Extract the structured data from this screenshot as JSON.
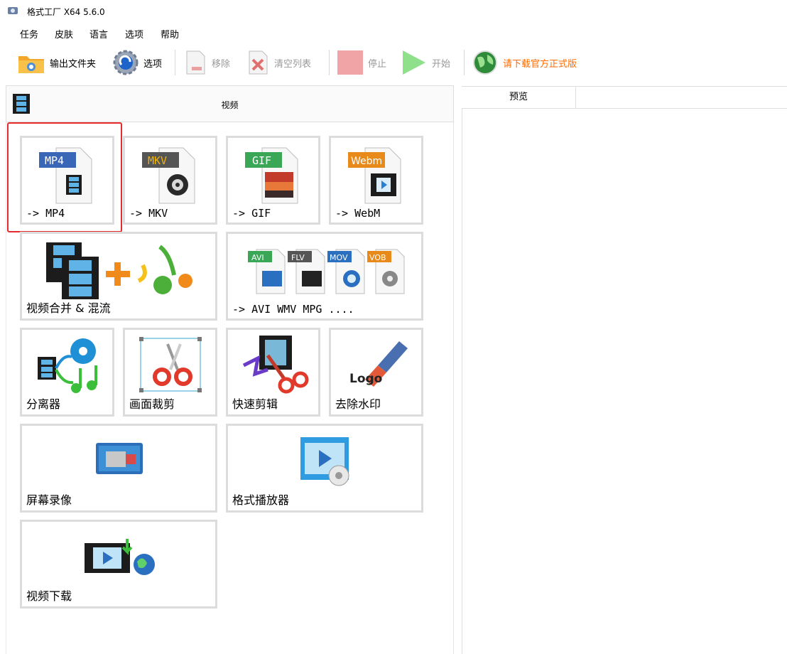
{
  "window": {
    "title": "格式工厂 X64 5.6.0",
    "icon": "format-factory-icon"
  },
  "menu": [
    "任务",
    "皮肤",
    "语言",
    "选项",
    "帮助"
  ],
  "toolbar": {
    "output_folder": "输出文件夹",
    "options": "选项",
    "remove": "移除",
    "clear_list": "清空列表",
    "stop": "停止",
    "start": "开始",
    "download_official": "请下载官方正式版"
  },
  "panel": {
    "title": "视频"
  },
  "preview": {
    "column": "预览"
  },
  "tiles": {
    "mp4": {
      "label": "-> MP4",
      "badge": "MP4",
      "badge_color": "#3a66b8"
    },
    "mkv": {
      "label": "-> MKV",
      "badge": "MKV",
      "badge_color": "#555555"
    },
    "gif": {
      "label": "-> GIF",
      "badge": "GIF",
      "badge_color": "#3aa757"
    },
    "webm": {
      "label": "-> WebM",
      "badge": "Webm",
      "badge_color": "#e88a1a"
    },
    "merge": {
      "label": "视频合并 & 混流"
    },
    "other": {
      "label": "-> AVI WMV MPG ....",
      "badges": [
        "AVI",
        "FLV",
        "MOV",
        "VOB"
      ]
    },
    "splitter": {
      "label": "分离器"
    },
    "crop": {
      "label": "画面裁剪"
    },
    "quick_edit": {
      "label": "快速剪辑"
    },
    "remove_logo": {
      "label": "去除水印",
      "logo_text": "Logo"
    },
    "screen_record": {
      "label": "屏幕录像"
    },
    "player": {
      "label": "格式播放器"
    },
    "download": {
      "label": "视频下载"
    }
  },
  "colors": {
    "highlight": "#e52b2b",
    "link": "#ff6a00",
    "tile_border": "#dcdcdc"
  }
}
